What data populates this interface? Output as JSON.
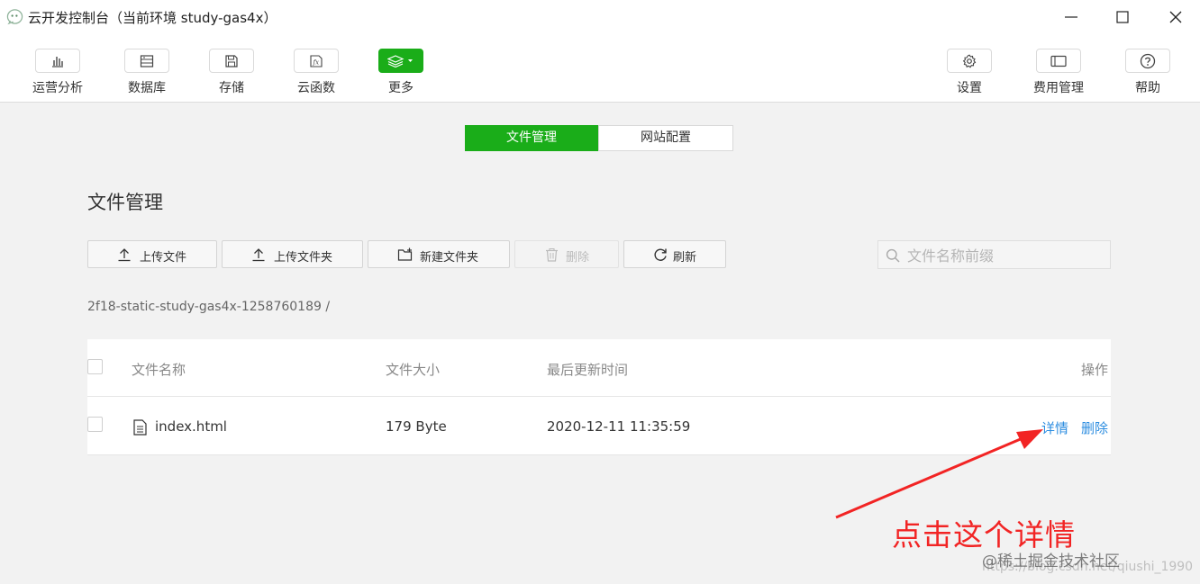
{
  "window": {
    "title": "云开发控制台（当前环境 study-gas4x）",
    "icons": [
      "wechat-devtools-icon",
      "minimize-icon",
      "maximize-icon",
      "close-icon"
    ]
  },
  "toolbar": {
    "left": [
      {
        "label": "运营分析",
        "icon": "bar-chart-icon"
      },
      {
        "label": "数据库",
        "icon": "database-icon"
      },
      {
        "label": "存储",
        "icon": "save-icon"
      },
      {
        "label": "云函数",
        "icon": "function-icon"
      },
      {
        "label": "更多",
        "icon": "layers-icon"
      }
    ],
    "right": [
      {
        "label": "设置",
        "icon": "gear-icon"
      },
      {
        "label": "费用管理",
        "icon": "card-icon"
      },
      {
        "label": "帮助",
        "icon": "help-icon"
      }
    ]
  },
  "tabs": {
    "active": "文件管理",
    "inactive": "网站配置"
  },
  "page": {
    "title": "文件管理",
    "path": "2f18-static-study-gas4x-1258760189  /"
  },
  "actions": {
    "upload_file": "上传文件",
    "upload_folder": "上传文件夹",
    "new_folder": "新建文件夹",
    "delete": "删除",
    "refresh": "刷新"
  },
  "search": {
    "placeholder": "文件名称前缀",
    "value": ""
  },
  "table": {
    "columns": [
      "文件名称",
      "文件大小",
      "最后更新时间",
      "操作"
    ],
    "rows": [
      {
        "name": "index.html",
        "size": "179 Byte",
        "updated": "2020-12-11 11:35:59",
        "detail": "详情",
        "delete": "删除"
      }
    ]
  },
  "annotation": {
    "text": "点击这个详情",
    "color": "#f22424"
  },
  "watermark": {
    "text": "@稀土掘金技术社区",
    "url": "https://blog.csdn.net/qiushi_1990"
  },
  "colors": {
    "accent": "#1aad19",
    "link": "#2c8de0"
  }
}
